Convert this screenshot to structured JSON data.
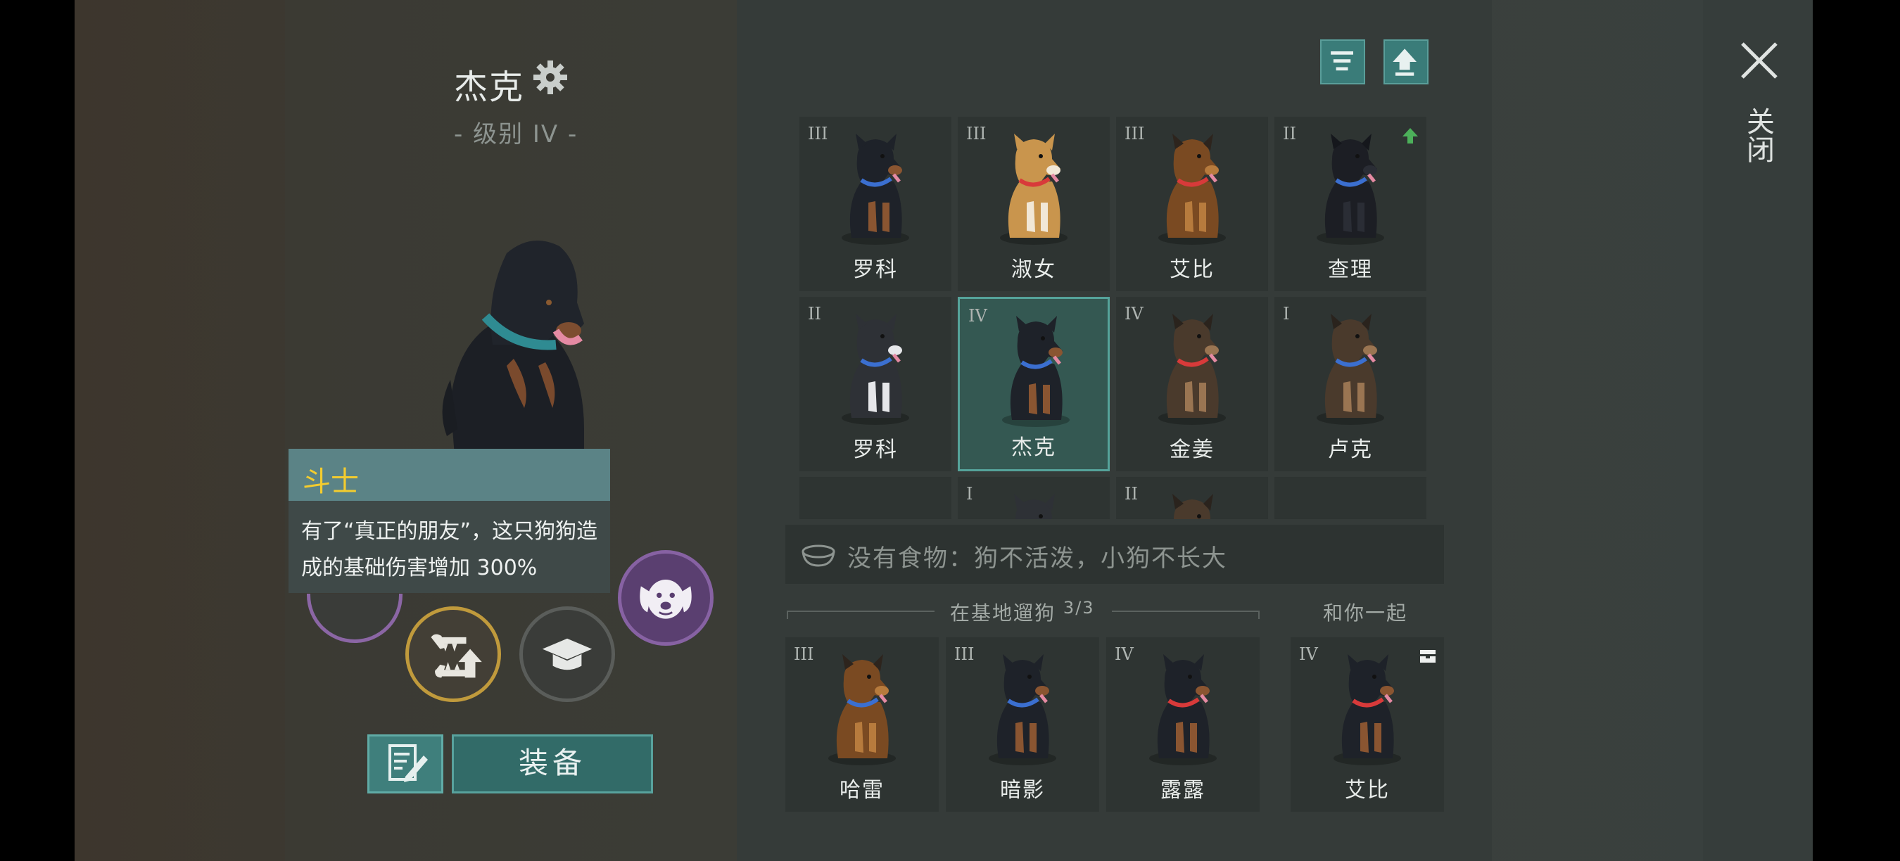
{
  "selected_dog": {
    "name": "杰克",
    "level": "- 级别 IV -"
  },
  "tooltip": {
    "title": "斗士",
    "text": "有了“真正的朋友”，这只狗狗造成的基础伤害增加 300%"
  },
  "buttons": {
    "equip": "装备",
    "close": "关闭"
  },
  "dogs": [
    {
      "rank": "III",
      "name": "罗科",
      "breed": "rottweiler",
      "collar": "#3b6fd0"
    },
    {
      "rank": "III",
      "name": "淑女",
      "breed": "shiba",
      "collar": "#d83a3a"
    },
    {
      "rank": "III",
      "name": "艾比",
      "breed": "shepherd",
      "collar": "#d83a3a"
    },
    {
      "rank": "II",
      "name": "查理",
      "breed": "puppy",
      "collar": "#3b6fd0",
      "upgrade": true
    },
    {
      "rank": "II",
      "name": "罗科",
      "breed": "husky",
      "collar": "#3b6fd0"
    },
    {
      "rank": "IV",
      "name": "杰克",
      "breed": "rottweiler",
      "collar": "#3b6fd0",
      "selected": true
    },
    {
      "rank": "IV",
      "name": "金姜",
      "breed": "shepherd-dark",
      "collar": "#d83a3a"
    },
    {
      "rank": "I",
      "name": "卢克",
      "breed": "shepherd-dark",
      "collar": "#3b6fd0"
    },
    {
      "rank": "",
      "name": "",
      "breed": ""
    },
    {
      "rank": "I",
      "name": "",
      "breed": "husky"
    },
    {
      "rank": "II",
      "name": "",
      "breed": "shepherd-dark"
    },
    {
      "rank": "",
      "name": "",
      "breed": ""
    }
  ],
  "food_status": "没有食物：狗不活泼，小狗不长大",
  "walking": {
    "label": "在基地遛狗",
    "count": "3/3"
  },
  "with_you_label": "和你一起",
  "walking_dogs": [
    {
      "rank": "III",
      "name": "哈雷",
      "breed": "shepherd",
      "collar": "#3b6fd0"
    },
    {
      "rank": "III",
      "name": "暗影",
      "breed": "rottweiler",
      "collar": "#3b6fd0"
    },
    {
      "rank": "IV",
      "name": "露露",
      "breed": "rottweiler",
      "collar": "#d83a3a"
    }
  ],
  "companion_dog": {
    "rank": "IV",
    "name": "艾比",
    "breed": "rottweiler",
    "collar": "#d83a3a"
  },
  "colors": {
    "accent": "#3a7c79",
    "tooltip_title": "#f3cc2e"
  }
}
